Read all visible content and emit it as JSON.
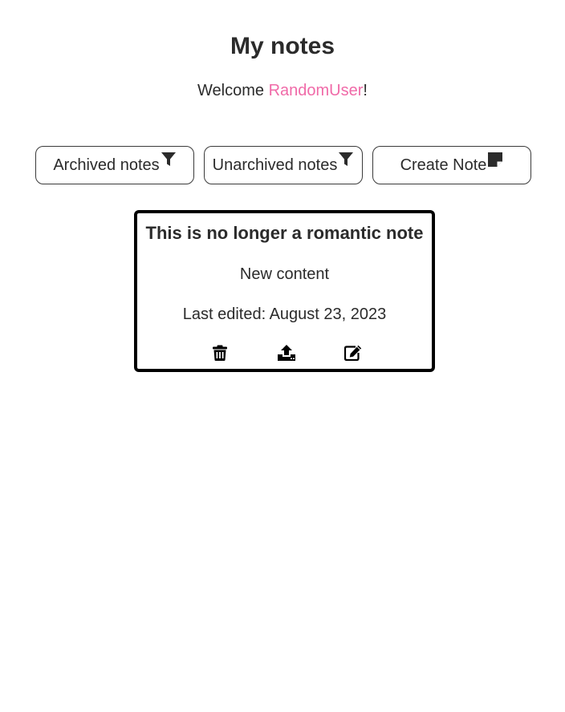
{
  "header": {
    "title": "My notes",
    "welcome_prefix": "Welcome ",
    "username": "RandomUser",
    "welcome_suffix": "!"
  },
  "toolbar": {
    "archived_label": "Archived notes",
    "archived_icon": "filter-icon",
    "unarchived_label": "Unarchived notes",
    "unarchived_icon": "filter-icon",
    "create_label": "Create Note",
    "create_icon": "sticky-note-icon"
  },
  "notes": [
    {
      "title": "This is no longer a romantic note",
      "content": "New content",
      "last_edited": "Last edited: August 23, 2023",
      "actions": [
        "trash-icon",
        "upload-icon",
        "edit-icon"
      ]
    }
  ],
  "colors": {
    "text": "#2b2b2b",
    "accent_username": "#f06aa8",
    "card_border": "#000000"
  }
}
